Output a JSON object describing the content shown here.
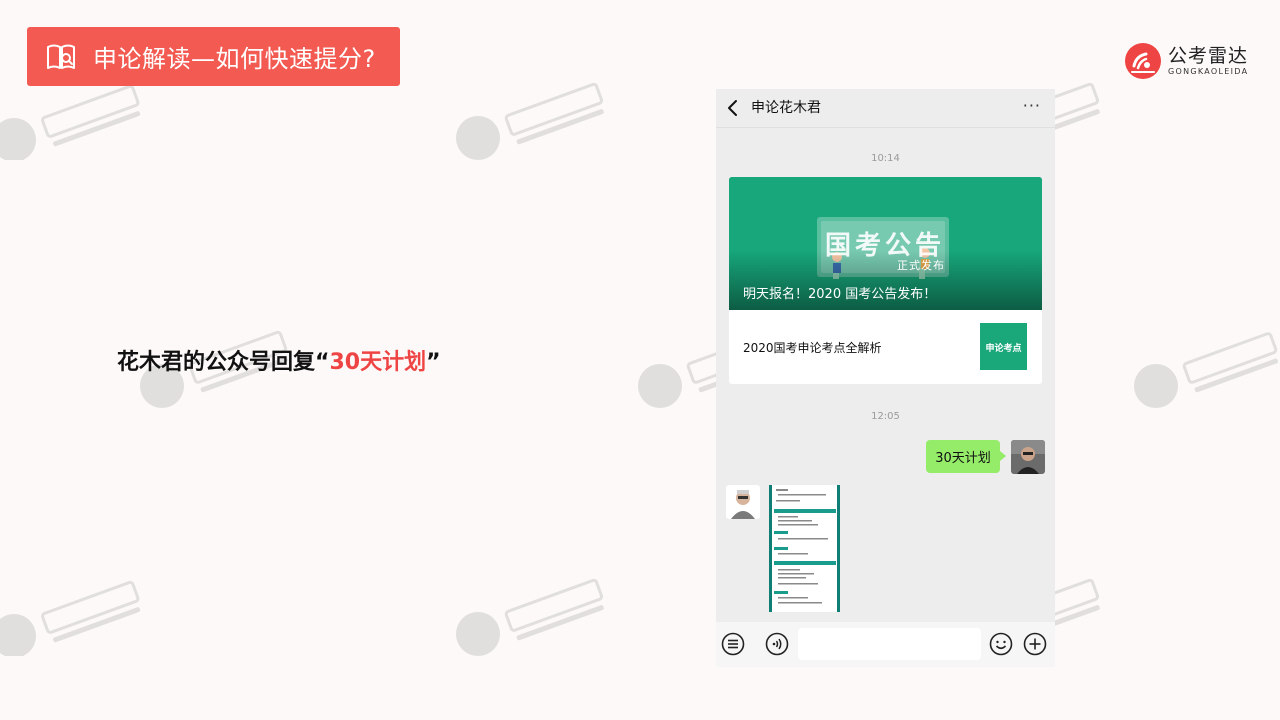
{
  "header": {
    "title": "申论解读—如何快速提分?",
    "icon": "book-search-icon",
    "accent": "#f25a52"
  },
  "brand": {
    "name_cn": "公考雷达",
    "name_en": "GONGKAOLEIDA",
    "icon": "radar-logo-icon",
    "color": "#ef4444"
  },
  "watermark": {
    "text_cn": "公考雷达",
    "text_en": "GONGKAOLEIDA"
  },
  "caption": {
    "prefix": "花木君的公众号回复",
    "open_quote": "“",
    "highlight": "30天计划",
    "close_quote": "”",
    "highlight_color": "#ef4444"
  },
  "phone": {
    "nav": {
      "back_icon": "chevron-left-icon",
      "title": "申论花木君",
      "more_label": "···"
    },
    "messages": {
      "time1": "10:14",
      "article_card": {
        "cover_banner_text": "国考公告",
        "cover_banner_sub": "正式发布",
        "cover_title": "明天报名！2020 国考公告发布！",
        "sub_item_title": "2020国考申论考点全解析",
        "sub_item_thumb_text": "申论考点"
      },
      "time2": "12:05",
      "sent_text": "30天计划",
      "received": "document-image"
    },
    "input_bar": {
      "menu_icon": "menu-list-icon",
      "voice_icon": "voice-icon",
      "emoji_icon": "emoji-icon",
      "add_icon": "plus-circle-icon"
    }
  }
}
